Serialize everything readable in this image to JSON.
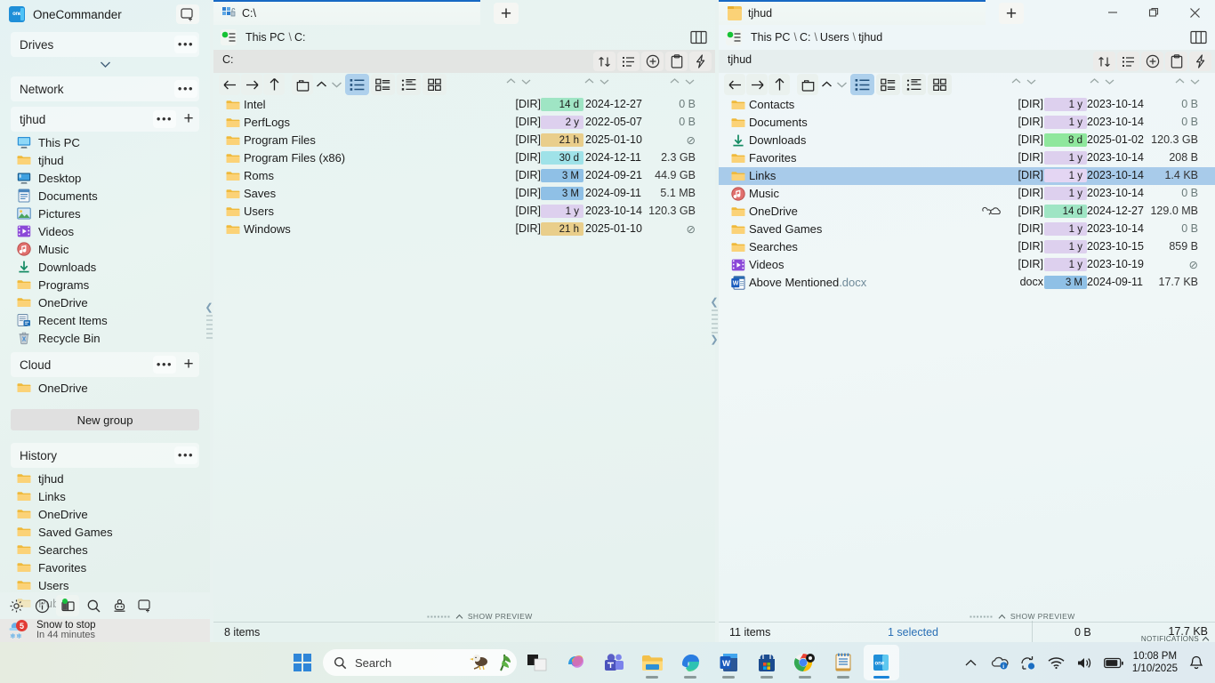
{
  "app": {
    "name": "OneCommander"
  },
  "sidebar": {
    "groups": [
      {
        "title": "Drives",
        "has_plus": false,
        "has_chevron": true,
        "items": []
      },
      {
        "title": "Network",
        "has_plus": false,
        "has_chevron": false,
        "items": []
      },
      {
        "title": "tjhud",
        "has_plus": true,
        "has_chevron": false,
        "items": [
          {
            "label": "This PC",
            "icon": "monitor-icon"
          },
          {
            "label": "tjhud",
            "icon": "folder-icon"
          },
          {
            "label": "Desktop",
            "icon": "desktop-icon"
          },
          {
            "label": "Documents",
            "icon": "documents-icon"
          },
          {
            "label": "Pictures",
            "icon": "pictures-icon"
          },
          {
            "label": "Videos",
            "icon": "videos-icon"
          },
          {
            "label": "Music",
            "icon": "music-icon"
          },
          {
            "label": "Downloads",
            "icon": "download-icon"
          },
          {
            "label": "Programs",
            "icon": "folder-icon"
          },
          {
            "label": "OneDrive",
            "icon": "folder-icon"
          },
          {
            "label": "Recent Items",
            "icon": "recent-items-icon"
          },
          {
            "label": "Recycle Bin",
            "icon": "recycle-bin-icon"
          }
        ]
      },
      {
        "title": "Cloud",
        "has_plus": true,
        "has_chevron": false,
        "items": [
          {
            "label": "OneDrive",
            "icon": "folder-icon"
          }
        ]
      }
    ],
    "new_group_label": "New group",
    "history": {
      "title": "History",
      "items": [
        {
          "label": "tjhud",
          "icon": "folder-icon"
        },
        {
          "label": "Links",
          "icon": "folder-icon"
        },
        {
          "label": "OneDrive",
          "icon": "folder-icon"
        },
        {
          "label": "Saved Games",
          "icon": "folder-icon"
        },
        {
          "label": "Searches",
          "icon": "folder-icon"
        },
        {
          "label": "Favorites",
          "icon": "folder-icon"
        },
        {
          "label": "Users",
          "icon": "folder-icon"
        },
        {
          "label": "Public",
          "icon": "folder-icon"
        }
      ]
    },
    "bottom_icons": [
      "gear-icon",
      "info-icon",
      "theme-icon",
      "search-icon",
      "robot-icon",
      "new-window-icon"
    ],
    "weather": {
      "title": "Snow to stop",
      "subtitle": "In 44 minutes",
      "badge": "5"
    }
  },
  "panelA": {
    "tab_label": "C:\\",
    "tab_icon": "drive-icon",
    "breadcrumbs": [
      "This PC",
      "C:"
    ],
    "toolbar_path": "C:",
    "toolbar_icons": [
      "sort-icon",
      "details-icon",
      "new-item-icon",
      "paste-icon",
      "flash-icon"
    ],
    "nav_icons": [
      "back-arrow-icon",
      "forward-arrow-icon",
      "up-arrow-icon",
      "new-folder-icon",
      "chevron-up-icon",
      "chevron-down-icon"
    ],
    "view_modes": [
      "list-view-icon",
      "tiles-view-icon",
      "details-view-icon",
      "grid-view-icon"
    ],
    "active_view_mode": 0,
    "rows": [
      {
        "name": "Intel",
        "icon": "folder-icon",
        "type": "[DIR]",
        "age": "14 d",
        "age_color": "#9fe5c4",
        "date": "2024-12-27",
        "size": "0 B",
        "size_muted": true
      },
      {
        "name": "PerfLogs",
        "icon": "folder-icon",
        "type": "[DIR]",
        "age": "2 y",
        "age_color": "#ddd0ee",
        "date": "2022-05-07",
        "size": "0 B",
        "size_muted": true
      },
      {
        "name": "Program Files",
        "icon": "folder-icon",
        "type": "[DIR]",
        "age": "21 h",
        "age_color": "#e9ce8b",
        "date": "2025-01-10",
        "size": "⊘",
        "size_muted": true
      },
      {
        "name": "Program Files (x86)",
        "icon": "folder-icon",
        "type": "[DIR]",
        "age": "30 d",
        "age_color": "#9fe2e8",
        "date": "2024-12-11",
        "size": "2.3 GB",
        "size_muted": false
      },
      {
        "name": "Roms",
        "icon": "folder-icon",
        "type": "[DIR]",
        "age": "3 M",
        "age_color": "#8fc0e6",
        "date": "2024-09-21",
        "size": "44.9 GB",
        "size_muted": false
      },
      {
        "name": "Saves",
        "icon": "folder-icon",
        "type": "[DIR]",
        "age": "3 M",
        "age_color": "#8fc0e6",
        "date": "2024-09-11",
        "size": "5.1 MB",
        "size_muted": false
      },
      {
        "name": "Users",
        "icon": "folder-icon",
        "type": "[DIR]",
        "age": "1 y",
        "age_color": "#ddd0ee",
        "date": "2023-10-14",
        "size": "120.3 GB",
        "size_muted": false
      },
      {
        "name": "Windows",
        "icon": "folder-icon",
        "type": "[DIR]",
        "age": "21 h",
        "age_color": "#e9ce8b",
        "date": "2025-01-10",
        "size": "⊘",
        "size_muted": true
      }
    ],
    "status": {
      "items": "8 items",
      "preview_label": "SHOW PREVIEW"
    }
  },
  "panelB": {
    "tab_label": "tjhud",
    "tab_icon": "folder-icon",
    "breadcrumbs": [
      "This PC",
      "C:",
      "Users",
      "tjhud"
    ],
    "toolbar_path": "tjhud",
    "toolbar_icons": [
      "sort-icon",
      "details-icon",
      "new-item-icon",
      "paste-icon",
      "flash-icon"
    ],
    "nav_icons": [
      "back-arrow-icon",
      "forward-arrow-icon",
      "up-arrow-icon",
      "new-folder-icon",
      "chevron-up-icon",
      "chevron-down-icon"
    ],
    "view_modes": [
      "list-view-icon",
      "tiles-view-icon",
      "details-view-icon",
      "grid-view-icon"
    ],
    "active_view_mode": 0,
    "window_controls": [
      "minimize-icon",
      "restore-icon",
      "close-icon"
    ],
    "rows": [
      {
        "name": "Contacts",
        "icon": "folder-icon",
        "type": "[DIR]",
        "age": "1 y",
        "age_color": "#ddd0ee",
        "date": "2023-10-14",
        "size": "0 B",
        "size_muted": true,
        "selected": false,
        "link": false
      },
      {
        "name": "Documents",
        "icon": "folder-icon",
        "type": "[DIR]",
        "age": "1 y",
        "age_color": "#ddd0ee",
        "date": "2023-10-14",
        "size": "0 B",
        "size_muted": true,
        "selected": false,
        "link": false
      },
      {
        "name": "Downloads",
        "icon": "download-icon",
        "type": "[DIR]",
        "age": "8 d",
        "age_color": "#8fe79d",
        "date": "2025-01-02",
        "size": "120.3 GB",
        "size_muted": false,
        "selected": false,
        "link": false
      },
      {
        "name": "Favorites",
        "icon": "folder-icon",
        "type": "[DIR]",
        "age": "1 y",
        "age_color": "#ddd0ee",
        "date": "2023-10-14",
        "size": "208 B",
        "size_muted": false,
        "selected": false,
        "link": false
      },
      {
        "name": "Links",
        "icon": "folder-icon",
        "type": "[DIR]",
        "age": "1 y",
        "age_color": "#e4d6f3",
        "date": "2023-10-14",
        "size": "1.4 KB",
        "size_muted": false,
        "selected": true,
        "link": false
      },
      {
        "name": "Music",
        "icon": "music-icon",
        "type": "[DIR]",
        "age": "1 y",
        "age_color": "#ddd0ee",
        "date": "2023-10-14",
        "size": "0 B",
        "size_muted": true,
        "selected": false,
        "link": false
      },
      {
        "name": "OneDrive",
        "icon": "folder-icon",
        "type": "[DIR]",
        "age": "14 d",
        "age_color": "#9fe5c4",
        "date": "2024-12-27",
        "size": "129.0 MB",
        "size_muted": false,
        "selected": false,
        "link": true
      },
      {
        "name": "Saved Games",
        "icon": "folder-icon",
        "type": "[DIR]",
        "age": "1 y",
        "age_color": "#ddd0ee",
        "date": "2023-10-14",
        "size": "0 B",
        "size_muted": true,
        "selected": false,
        "link": false
      },
      {
        "name": "Searches",
        "icon": "folder-icon",
        "type": "[DIR]",
        "age": "1 y",
        "age_color": "#ddd0ee",
        "date": "2023-10-15",
        "size": "859 B",
        "size_muted": false,
        "selected": false,
        "link": false
      },
      {
        "name": "Videos",
        "icon": "videos-icon",
        "type": "[DIR]",
        "age": "1 y",
        "age_color": "#ddd0ee",
        "date": "2023-10-19",
        "size": "⊘",
        "size_muted": true,
        "selected": false,
        "link": false
      },
      {
        "name": "Above Mentioned",
        "ext": ".docx",
        "icon": "word-icon",
        "type": "docx",
        "age": "3 M",
        "age_color": "#8fc0e6",
        "date": "2024-09-11",
        "size": "17.7 KB",
        "size_muted": false,
        "selected": false,
        "link": false
      }
    ],
    "status": {
      "items": "11 items",
      "selected": "1 selected",
      "preview_label": "SHOW PREVIEW",
      "sel_size": "0 B",
      "total_size": "17.7 KB",
      "notifications_label": "NOTIFICATIONS"
    }
  },
  "taskbar": {
    "search_placeholder": "Search",
    "apps": [
      "start-icon",
      "taskview-icon",
      "copilot-icon",
      "teams-icon",
      "file-explorer-icon",
      "edge-icon",
      "word-icon",
      "store-icon",
      "chrome-icon",
      "notepad-icon",
      "onecommander-icon"
    ],
    "tray_icons": [
      "chevron-up-icon",
      "onedrive-sync-icon",
      "update-icon",
      "wifi-icon",
      "volume-icon",
      "battery-icon",
      "bell-icon"
    ],
    "clock_time": "10:08 PM",
    "clock_date": "1/10/2025"
  },
  "colors": {
    "accent": "#1869c4",
    "selection": "#a8cbea",
    "link_blue": "#2a6fb5"
  }
}
